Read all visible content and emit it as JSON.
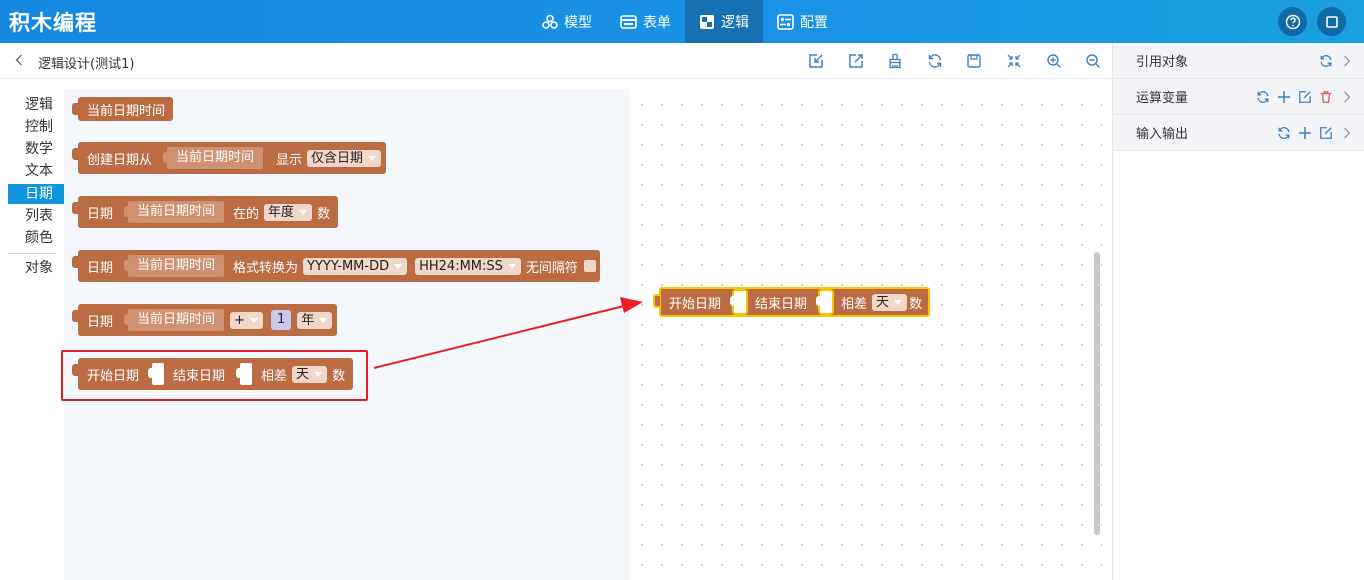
{
  "app": {
    "title": "积木编程"
  },
  "nav": {
    "tabs": [
      {
        "label": "模型",
        "icon": "model-icon",
        "active": false
      },
      {
        "label": "表单",
        "icon": "form-icon",
        "active": false
      },
      {
        "label": "逻辑",
        "icon": "logic-icon",
        "active": true
      },
      {
        "label": "配置",
        "icon": "config-icon",
        "active": false
      }
    ],
    "actions": [
      "help-icon",
      "fullscreen-icon"
    ]
  },
  "page": {
    "title": "逻辑设计(测试1)"
  },
  "toolbar": {
    "tools": [
      "import-icon",
      "export-icon",
      "clean-icon",
      "refresh-icon",
      "save-icon",
      "collapse-icon",
      "zoom-in-icon",
      "zoom-out-icon"
    ]
  },
  "categories": {
    "items": [
      "逻辑",
      "控制",
      "数学",
      "文本",
      "日期",
      "列表",
      "颜色"
    ],
    "active": "日期",
    "extra": "对象"
  },
  "blocks": {
    "b1": {
      "label": "当前日期时间"
    },
    "b2": {
      "prefix": "创建日期从",
      "inner": "当前日期时间",
      "mid": "显示",
      "dropdown": "仅含日期"
    },
    "b3": {
      "prefix": "日期",
      "inner": "当前日期时间",
      "mid": "在的",
      "dropdown": "年度",
      "suffix": "数"
    },
    "b4": {
      "prefix": "日期",
      "inner": "当前日期时间",
      "mid": "格式转换为",
      "date_format": "YYYY-MM-DD",
      "time_format": "HH24:MM:SS",
      "suffix": "无间隔符"
    },
    "b5": {
      "prefix": "日期",
      "inner": "当前日期时间",
      "op": "+",
      "number": "1",
      "unit": "年"
    },
    "b6": {
      "start": "开始日期",
      "end": "结束日期",
      "diff": "相差",
      "unit": "天",
      "suffix": "数"
    }
  },
  "canvas_block": {
    "start": "开始日期",
    "end": "结束日期",
    "diff": "相差",
    "unit": "天",
    "suffix": "数"
  },
  "right_panel": {
    "sections": [
      {
        "label": "引用对象",
        "icons": [
          "refresh-icon",
          "chevron-right-icon"
        ]
      },
      {
        "label": "运算变量",
        "icons": [
          "refresh-icon",
          "add-icon",
          "edit-icon",
          "delete-icon",
          "chevron-right-icon"
        ]
      },
      {
        "label": "输入输出",
        "icons": [
          "refresh-icon",
          "add-icon",
          "edit-icon",
          "chevron-right-icon"
        ]
      }
    ]
  },
  "colors": {
    "accent": "#1a8fe3",
    "block": "#bb6c43",
    "highlight": "#e51c23",
    "selected": "#f8c600",
    "delete": "#e25b5b"
  }
}
